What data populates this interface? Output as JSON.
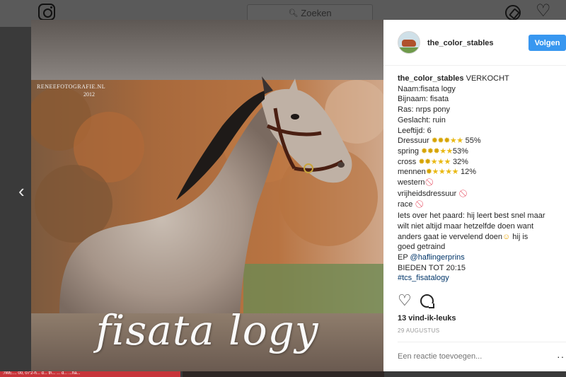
{
  "header": {
    "search_placeholder": "Zoeken",
    "logo_icon": "instagram-logo-icon",
    "explore_icon": "compass-icon",
    "activity_icon": "heart-icon"
  },
  "background_strip": {
    "text": ":/WE.... 00, 07'2-h... d... th... ... d... ...ha..."
  },
  "post": {
    "photo_credit": "RENEEFOTOGRAFIE.NL",
    "photo_year": "2012",
    "image_title": "fisata logy"
  },
  "panel": {
    "username": "the_color_stables",
    "follow_label": "Volgen",
    "caption": {
      "status": "VERKOCHT",
      "naam": "Naam:fisata logy",
      "bijnaam": "Bijnaam: fisata",
      "ras": "Ras: nrps pony",
      "geslacht": "Geslacht: ruin",
      "leeftijd": "Leeftijd: 6",
      "dressuur_label": "Dressuur",
      "dressuur_pct": "55%",
      "spring_label": "spring",
      "spring_pct": "53%",
      "cross_label": "cross",
      "cross_pct": "32%",
      "mennen_label": "mennen",
      "mennen_pct": "12%",
      "western": "western",
      "vrijheidsdressuur": "vrijheidsdressuur",
      "race": "race",
      "about_1": "Iets over het paard: hij leert best snel maar",
      "about_2": "wilt niet altijd maar hetzelfde doen want",
      "about_3": "anders gaat ie vervelend doen",
      "about_3b": "hij is",
      "about_4": "goed getraind",
      "ep_label": "EP",
      "ep_handle": "@haflingerprins",
      "bieden": "BIEDEN TOT 20:15",
      "hashtag": "#tcs_fisatalogy"
    },
    "likes": "13 vind-ik-leuks",
    "date": "29 AUGUSTUS",
    "comment_placeholder": "Een reactie toevoegen...",
    "more_label": "···"
  },
  "colors": {
    "follow_blue": "#3897f0",
    "link_blue": "#003569",
    "star_yellow": "#e9b914"
  }
}
